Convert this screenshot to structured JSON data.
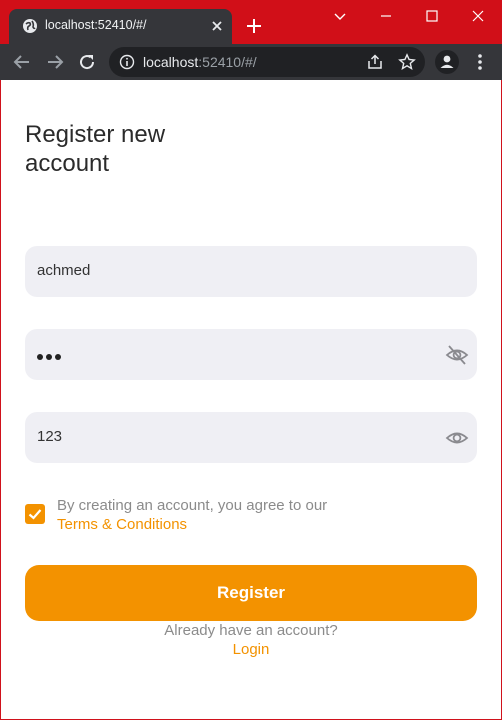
{
  "browser": {
    "tab_title": "localhost:52410/#/",
    "url_host": "localhost",
    "url_rest": ":52410/#/"
  },
  "form": {
    "heading": "Register new account",
    "username_value": "achmed",
    "password_masked_length": 3,
    "confirm_password_value": "123",
    "terms_checked": true,
    "terms_text": "By creating an account, you agree to our",
    "terms_link": "Terms & Conditions",
    "register_label": "Register",
    "already_text": "Already have an account?",
    "login_link": "Login"
  },
  "colors": {
    "accent": "#f39200",
    "field_bg": "#efeff4",
    "frame": "#d10f18",
    "toolbar": "#35363a"
  }
}
